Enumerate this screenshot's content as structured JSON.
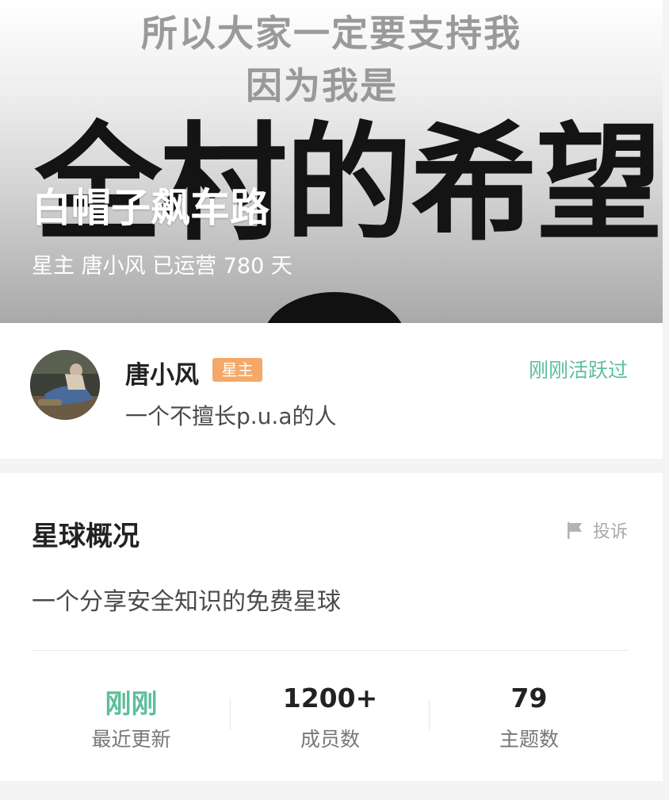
{
  "cover": {
    "line1": "所以大家一定要支持我",
    "line2": "因为我是",
    "big_text": "全村的希望",
    "title": "白帽子飙车路",
    "subtitle": "星主 唐小风 已运营 780 天"
  },
  "owner": {
    "name": "唐小风",
    "badge": "星主",
    "badge_color": "#f4a96a",
    "active_status": "刚刚活跃过",
    "bio": "一个不擅长p.u.a的人",
    "avatar_icon": "avatar"
  },
  "overview": {
    "title": "星球概况",
    "report_label": "投诉",
    "report_icon": "flag-icon",
    "description": "一个分享安全知识的免费星球",
    "stats": [
      {
        "value": "刚刚",
        "label": "最近更新"
      },
      {
        "value": "1200+",
        "label": "成员数"
      },
      {
        "value": "79",
        "label": "主题数"
      }
    ]
  },
  "colors": {
    "accent_green": "#5dbf9a",
    "text_primary": "#222222",
    "text_secondary": "#777777",
    "page_bg": "#f4f4f4"
  }
}
